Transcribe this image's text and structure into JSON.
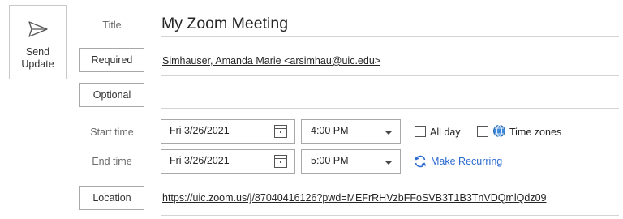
{
  "send_update": {
    "label_line1": "Send",
    "label_line2": "Update"
  },
  "title": {
    "label": "Title",
    "value": "My Zoom Meeting"
  },
  "required": {
    "button_label": "Required",
    "value": "Simhauser, Amanda Marie <arsimhau@uic.edu>"
  },
  "optional": {
    "button_label": "Optional",
    "value": ""
  },
  "start": {
    "label": "Start time",
    "date": "Fri 3/26/2021",
    "time": "4:00 PM"
  },
  "end": {
    "label": "End time",
    "date": "Fri 3/26/2021",
    "time": "5:00 PM"
  },
  "options": {
    "all_day_label": "All day",
    "all_day_checked": false,
    "time_zones_label": "Time zones",
    "time_zones_checked": false,
    "make_recurring_label": "Make Recurring"
  },
  "location": {
    "button_label": "Location",
    "value": "https://uic.zoom.us/j/87040416126?pwd=MEFrRHVzbFFoSVB3T1B3TnVDQmlQdz09"
  },
  "colors": {
    "link_blue": "#2b6ad0",
    "border": "#a8a8a8",
    "label_gray": "#6b6b6b"
  },
  "icons": {
    "send": "send-icon",
    "calendar": "calendar-icon",
    "globe": "globe-icon",
    "recurring": "recurring-icon",
    "dropdown": "chevron-down-icon"
  }
}
